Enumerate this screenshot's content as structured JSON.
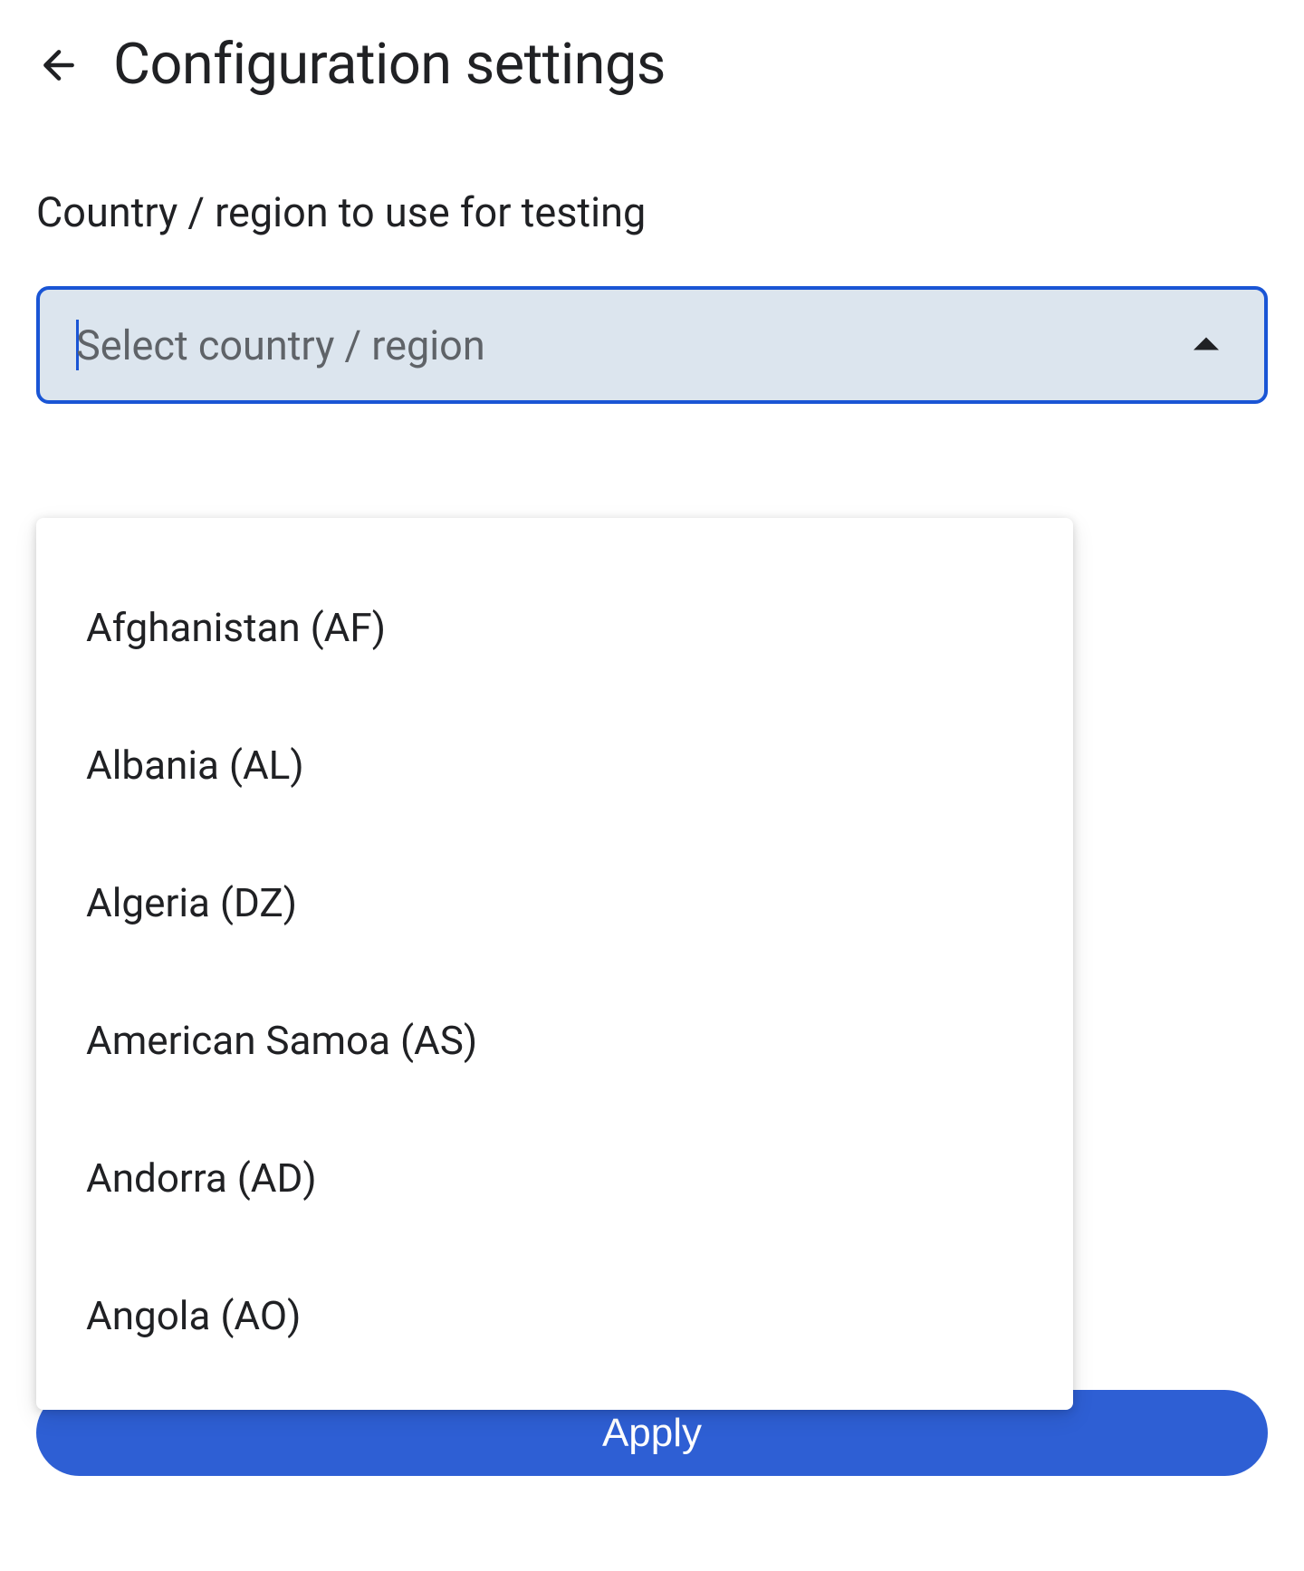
{
  "header": {
    "title": "Configuration settings"
  },
  "field": {
    "label": "Country / region to use for testing",
    "placeholder": "Select country / region"
  },
  "dropdown": {
    "options": [
      "Afghanistan (AF)",
      "Albania (AL)",
      "Algeria (DZ)",
      "American Samoa (AS)",
      "Andorra (AD)",
      "Angola (AO)"
    ]
  },
  "actions": {
    "apply_label": "Apply"
  }
}
